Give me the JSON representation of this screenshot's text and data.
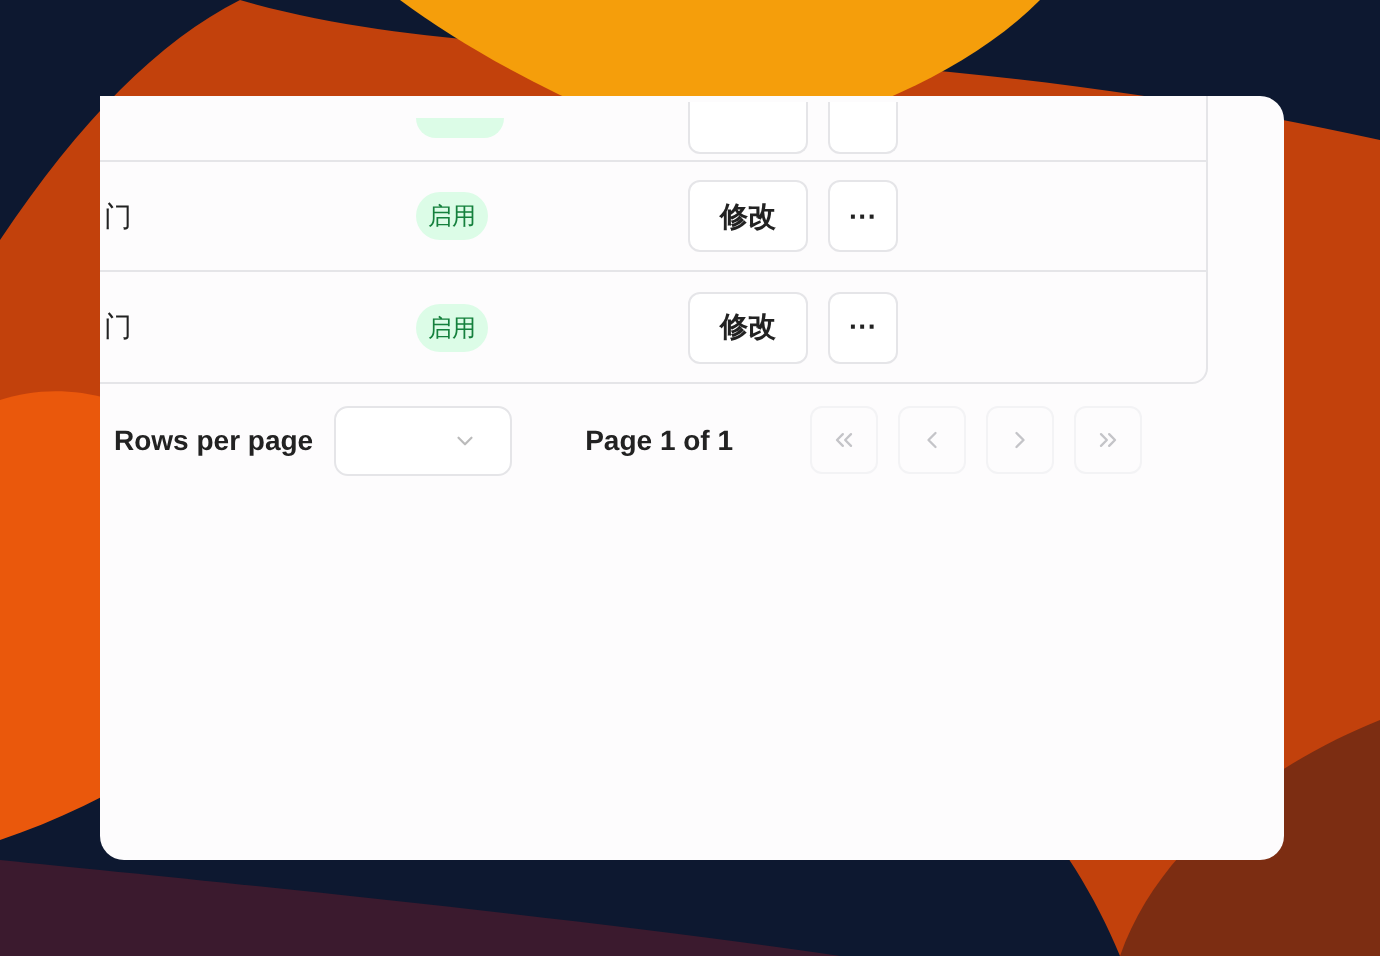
{
  "table": {
    "rows": [
      {
        "name": "门",
        "status": "启用",
        "enabled": true,
        "actions": [
          "修改",
          "···"
        ]
      },
      {
        "name": "门",
        "status": "启用",
        "enabled": true,
        "actions": [
          "修改",
          "···"
        ]
      }
    ]
  },
  "pagination": {
    "rows_per_page_label": "Rows per page",
    "page_label": "Page 1 of 1",
    "buttons": [
      {
        "kind": "first",
        "disabled": true
      },
      {
        "kind": "prev",
        "disabled": true
      },
      {
        "kind": "next",
        "disabled": true
      },
      {
        "kind": "last",
        "disabled": true
      }
    ]
  }
}
